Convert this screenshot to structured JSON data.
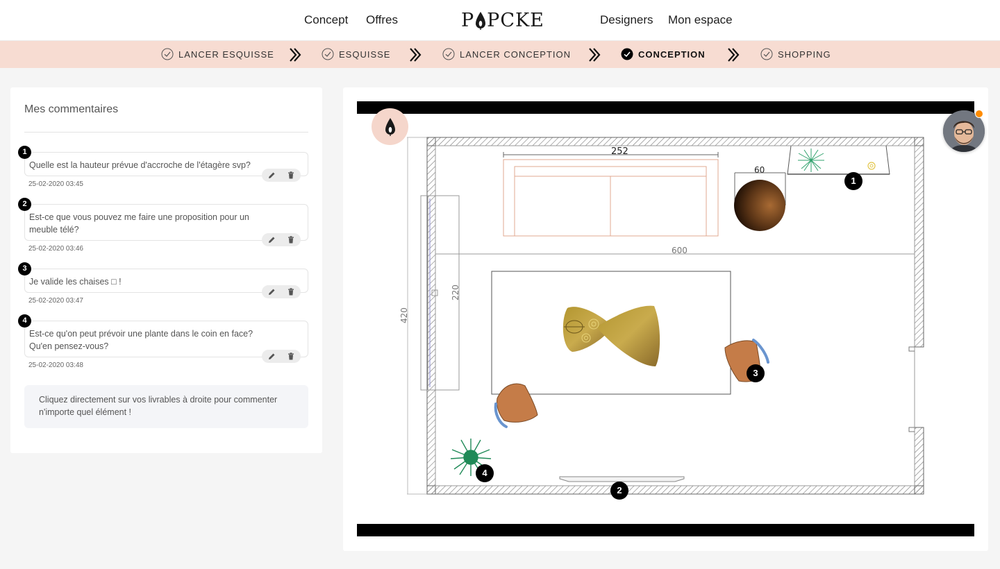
{
  "nav": {
    "concept": "Concept",
    "offres": "Offres",
    "logo": "PIPCKE",
    "designers": "Designers",
    "mon_espace": "Mon espace"
  },
  "steps": [
    {
      "label": "LANCER ESQUISSE",
      "state": "done"
    },
    {
      "label": "ESQUISSE",
      "state": "done"
    },
    {
      "label": "LANCER CONCEPTION",
      "state": "done"
    },
    {
      "label": "CONCEPTION",
      "state": "current"
    },
    {
      "label": "SHOPPING",
      "state": "done"
    }
  ],
  "comments_panel": {
    "title": "Mes commentaires",
    "comments": [
      {
        "num": "1",
        "text": "Quelle est la hauteur prévue d'accroche de l'étagère svp?",
        "date": "25-02-2020 03:45"
      },
      {
        "num": "2",
        "text": "Est-ce que vous pouvez me faire une proposition pour un meuble télé?",
        "date": "25-02-2020 03:46"
      },
      {
        "num": "3",
        "text": "Je valide les chaises □ !",
        "date": "25-02-2020 03:47"
      },
      {
        "num": "4",
        "text": "Est-ce qu'on peut prévoir une plante dans le coin en face? Qu'en pensez-vous?",
        "date": "25-02-2020 03:48"
      }
    ],
    "hint": "Cliquez directement sur vos livrables à droite pour commenter n'importe quel élément !",
    "edit_icon": "pencil-icon",
    "delete_icon": "trash-icon"
  },
  "plan": {
    "dimensions": {
      "sofa_width": "252",
      "table_width": "60",
      "room_length": "600",
      "room_depth": "420",
      "inner_depth": "220"
    },
    "pins": [
      "1",
      "2",
      "3",
      "4"
    ]
  },
  "colors": {
    "step_bar": "#f7dcd2",
    "avatar_dot": "#ff8c00",
    "panel_bg": "#ffffff",
    "page_bg": "#f5f5f5"
  }
}
